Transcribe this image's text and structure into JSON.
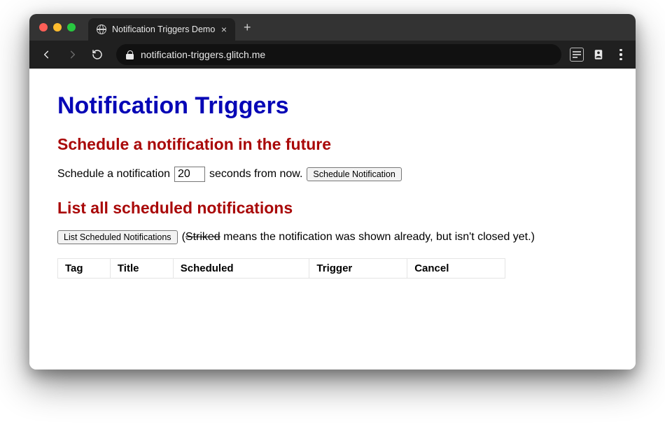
{
  "browser": {
    "tab_title": "Notification Triggers Demo",
    "url": "notification-triggers.glitch.me"
  },
  "page": {
    "title": "Notification Triggers",
    "schedule": {
      "heading": "Schedule a notification in the future",
      "label_before": "Schedule a notification",
      "seconds_value": "20",
      "label_after": "seconds from now.",
      "button": "Schedule Notification"
    },
    "list": {
      "heading": "List all scheduled notifications",
      "button": "List Scheduled Notifications",
      "legend_open": "(",
      "legend_striked": "Striked",
      "legend_rest": " means the notification was shown already, but isn't closed yet.)",
      "columns": [
        "Tag",
        "Title",
        "Scheduled",
        "Trigger",
        "Cancel"
      ]
    }
  }
}
